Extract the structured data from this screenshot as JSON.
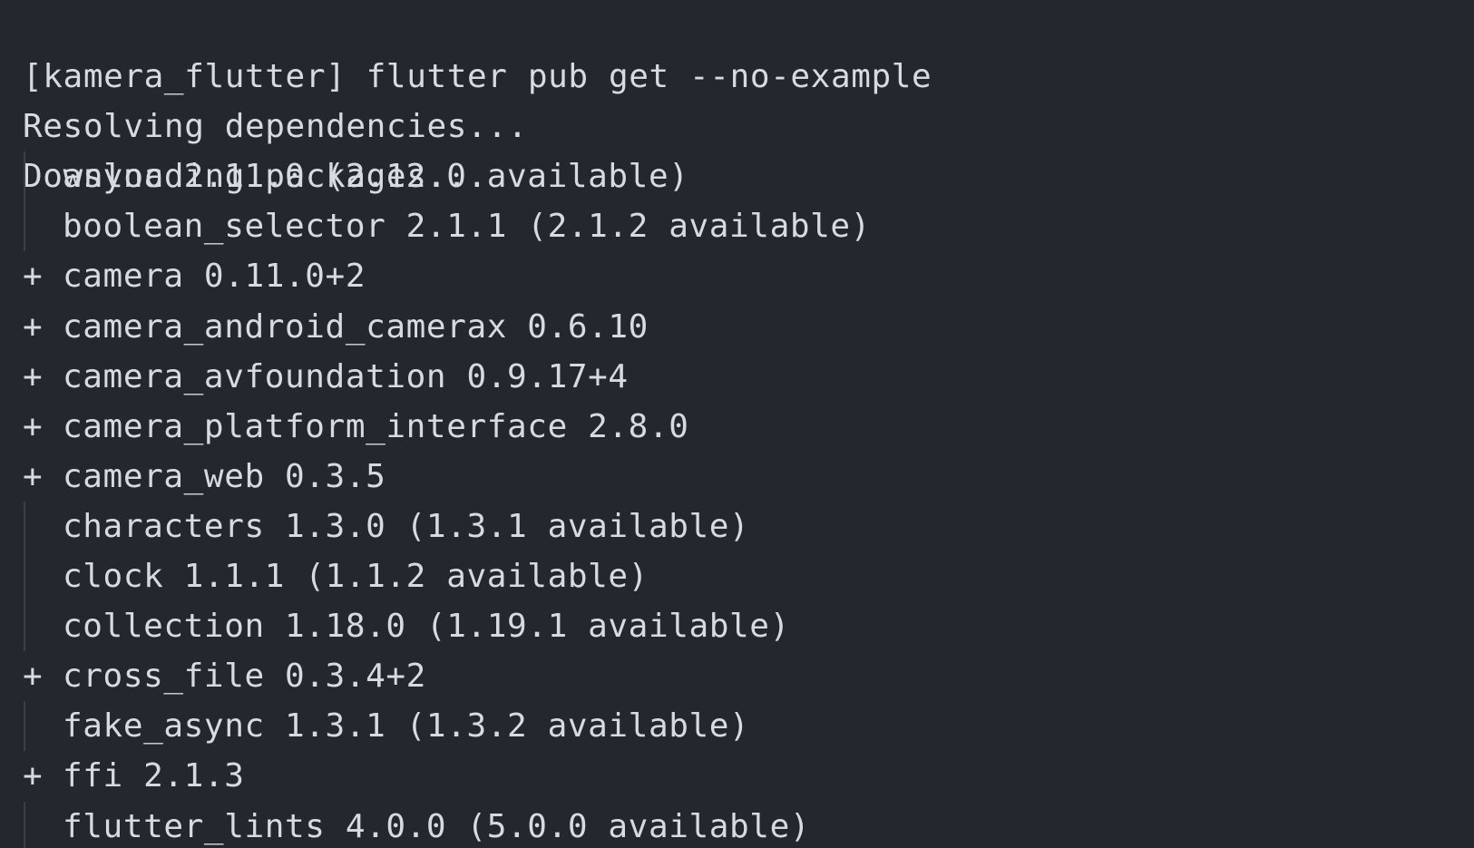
{
  "terminal": {
    "command_line": "[kamera_flutter] flutter pub get --no-example",
    "status_lines": [
      "Resolving dependencies...",
      "Downloading packages..."
    ],
    "packages": [
      {
        "marker": "",
        "text": "async 2.11.0 (2.12.0 available)"
      },
      {
        "marker": "",
        "text": "boolean_selector 2.1.1 (2.1.2 available)"
      },
      {
        "marker": "+",
        "text": "camera 0.11.0+2"
      },
      {
        "marker": "+",
        "text": "camera_android_camerax 0.6.10"
      },
      {
        "marker": "+",
        "text": "camera_avfoundation 0.9.17+4"
      },
      {
        "marker": "+",
        "text": "camera_platform_interface 2.8.0"
      },
      {
        "marker": "+",
        "text": "camera_web 0.3.5"
      },
      {
        "marker": "",
        "text": "characters 1.3.0 (1.3.1 available)"
      },
      {
        "marker": "",
        "text": "clock 1.1.1 (1.1.2 available)"
      },
      {
        "marker": "",
        "text": "collection 1.18.0 (1.19.1 available)"
      },
      {
        "marker": "+",
        "text": "cross_file 0.3.4+2"
      },
      {
        "marker": "",
        "text": "fake_async 1.3.1 (1.3.2 available)"
      },
      {
        "marker": "+",
        "text": "ffi 2.1.3"
      },
      {
        "marker": "",
        "text": "flutter_lints 4.0.0 (5.0.0 available)"
      }
    ],
    "colors": {
      "background": "#24272e",
      "foreground": "#d7dae0",
      "guide": "#3b3f47"
    }
  }
}
